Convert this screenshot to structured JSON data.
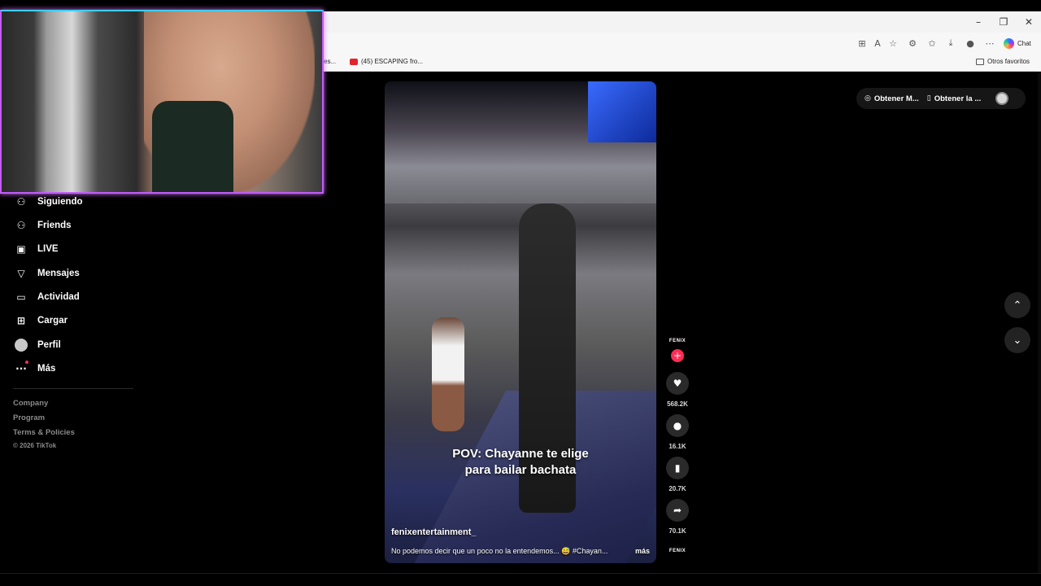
{
  "browser": {
    "window_controls": {
      "minimize": "–",
      "restore": "❐",
      "close": "✕"
    },
    "toolbar_icons": [
      "apps-icon",
      "translate-icon",
      "star-icon",
      "extensions-icon",
      "favorites-icon",
      "download-icon",
      "profile-icon",
      "more-icon"
    ],
    "chat_label": "Chat",
    "bookmarks": {
      "partial_left": "es...",
      "youtube_item": "(45) ESCAPING fro...",
      "other_favorites": "Otros favoritos"
    }
  },
  "sidebar": {
    "items": [
      {
        "label": "Siguiendo",
        "icon": "following-icon",
        "glyph": "⚇"
      },
      {
        "label": "Friends",
        "icon": "friends-icon",
        "glyph": "⚇"
      },
      {
        "label": "LIVE",
        "icon": "live-icon",
        "glyph": "▣"
      },
      {
        "label": "Mensajes",
        "icon": "messages-icon",
        "glyph": "▽"
      },
      {
        "label": "Actividad",
        "icon": "activity-icon",
        "glyph": "▭"
      },
      {
        "label": "Cargar",
        "icon": "upload-icon",
        "glyph": "⊞"
      },
      {
        "label": "Perfil",
        "icon": "profile-avatar",
        "glyph": ""
      },
      {
        "label": "Más",
        "icon": "more-icon",
        "glyph": "···"
      }
    ],
    "footer": {
      "company": "Company",
      "program": "Program",
      "terms": "Terms & Policies",
      "copyright": "© 2026 TikTok"
    }
  },
  "top_actions": {
    "get_app_1": "Obtener M...",
    "get_app_2": "Obtener la ..."
  },
  "video": {
    "caption_line1": "POV: Chayanne te elige",
    "caption_line2": "para bailar bachata",
    "username": "fenixentertainment_",
    "description": "No podemos decir que un poco no la entendemos... 😅 #Chayan...",
    "more": "más"
  },
  "rail": {
    "brand": "FENIX",
    "likes": "568.2K",
    "comments": "16.1K",
    "saves": "20.7K",
    "shares": "70.1K",
    "brand_bottom": "FENIX"
  },
  "nav": {
    "up_glyph": "⌃",
    "down_glyph": "⌄"
  },
  "colors": {
    "accent": "#fe2c55",
    "webcam_border_top": "#3ad0ff",
    "webcam_border": "#c45bff"
  }
}
